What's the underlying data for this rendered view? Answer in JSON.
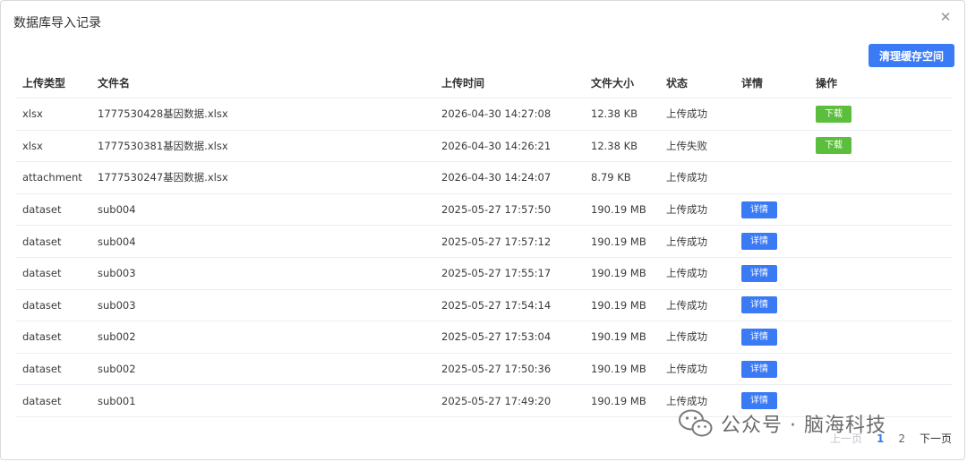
{
  "dialog": {
    "title": "数据库导入记录",
    "close_icon": "close-icon",
    "clear_button": "清理缓存空间"
  },
  "table": {
    "headers": {
      "type": "上传类型",
      "filename": "文件名",
      "time": "上传时间",
      "size": "文件大小",
      "status": "状态",
      "detail": "详情",
      "action": "操作"
    },
    "rows": [
      {
        "type": "xlsx",
        "filename": "1777530428基因数据.xlsx",
        "time": "2026-04-30 14:27:08",
        "size": "12.38 KB",
        "status": "上传成功",
        "detail": "",
        "action": "下载"
      },
      {
        "type": "xlsx",
        "filename": "1777530381基因数据.xlsx",
        "time": "2026-04-30 14:26:21",
        "size": "12.38 KB",
        "status": "上传失败",
        "detail": "",
        "action": "下载"
      },
      {
        "type": "attachment",
        "filename": "1777530247基因数据.xlsx",
        "time": "2026-04-30 14:24:07",
        "size": "8.79 KB",
        "status": "上传成功",
        "detail": "",
        "action": ""
      },
      {
        "type": "dataset",
        "filename": "sub004",
        "time": "2025-05-27 17:57:50",
        "size": "190.19 MB",
        "status": "上传成功",
        "detail": "详情",
        "action": ""
      },
      {
        "type": "dataset",
        "filename": "sub004",
        "time": "2025-05-27 17:57:12",
        "size": "190.19 MB",
        "status": "上传成功",
        "detail": "详情",
        "action": ""
      },
      {
        "type": "dataset",
        "filename": "sub003",
        "time": "2025-05-27 17:55:17",
        "size": "190.19 MB",
        "status": "上传成功",
        "detail": "详情",
        "action": ""
      },
      {
        "type": "dataset",
        "filename": "sub003",
        "time": "2025-05-27 17:54:14",
        "size": "190.19 MB",
        "status": "上传成功",
        "detail": "详情",
        "action": ""
      },
      {
        "type": "dataset",
        "filename": "sub002",
        "time": "2025-05-27 17:53:04",
        "size": "190.19 MB",
        "status": "上传成功",
        "detail": "详情",
        "action": ""
      },
      {
        "type": "dataset",
        "filename": "sub002",
        "time": "2025-05-27 17:50:36",
        "size": "190.19 MB",
        "status": "上传成功",
        "detail": "详情",
        "action": ""
      },
      {
        "type": "dataset",
        "filename": "sub001",
        "time": "2025-05-27 17:49:20",
        "size": "190.19 MB",
        "status": "上传成功",
        "detail": "详情",
        "action": ""
      }
    ]
  },
  "pagination": {
    "prev": "上一页",
    "pages": [
      "1",
      "2"
    ],
    "current": "1",
    "next": "下一页"
  },
  "watermark": {
    "icon": "wechat-icon",
    "text": "公众号 · 脑海科技"
  },
  "colors": {
    "primary": "#3a7af5",
    "success": "#5cbe3d"
  }
}
